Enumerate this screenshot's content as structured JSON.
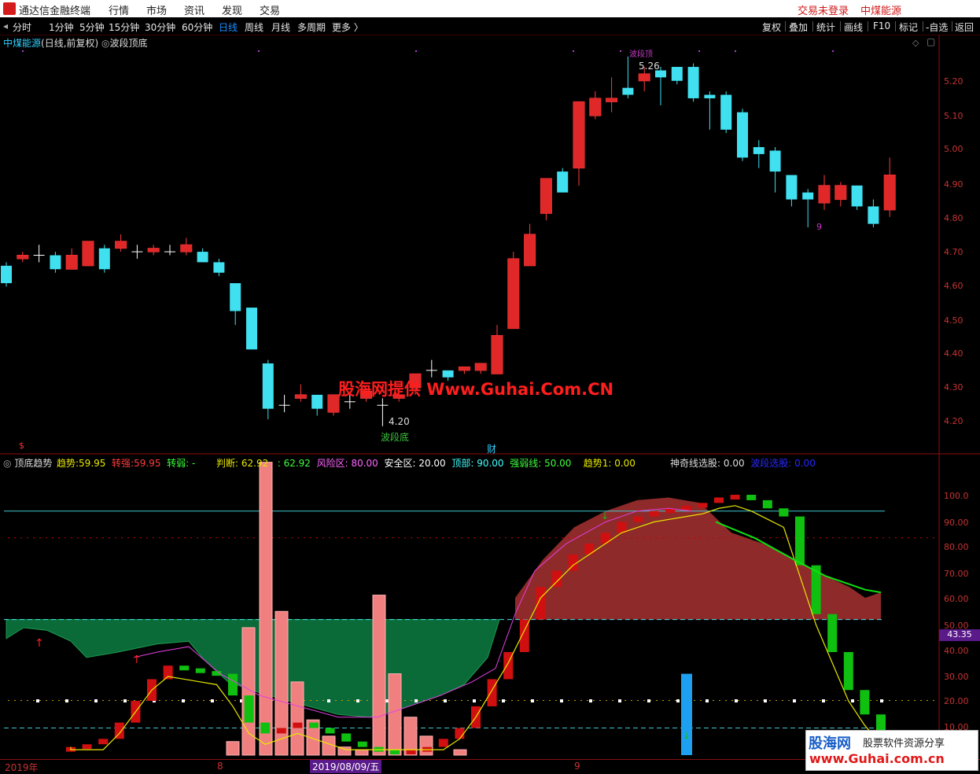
{
  "menubar": {
    "app_title": "通达信金融终端",
    "items": [
      "行情",
      "市场",
      "资讯",
      "发现",
      "交易"
    ],
    "login_status": "交易未登录",
    "stock": "中煤能源"
  },
  "toolbar": {
    "periods": [
      "分时",
      "1分钟",
      "5分钟",
      "15分钟",
      "30分钟",
      "60分钟",
      "日线",
      "周线",
      "月线",
      "多周期",
      "更多 〉"
    ],
    "active_period": "日线",
    "right_buttons": [
      "复权",
      "叠加",
      "统计",
      "画线",
      "F10",
      "标记",
      "-自选",
      "返回"
    ]
  },
  "main_chart": {
    "stock_name": "中煤能源",
    "mode": "(日线,前复权)",
    "indicator": "波段顶底",
    "high_label": "5.26",
    "low_label": "4.20",
    "low_note": "波段底",
    "top_note": "波段顶",
    "count_label": "9",
    "finance_mark": "财",
    "bottom_mark": "$",
    "watermark": "股海网提供 Www.Guhai.Com.CN",
    "yticks": [
      "5.20",
      "5.10",
      "5.00",
      "4.90",
      "4.80",
      "4.70",
      "4.60",
      "4.50",
      "4.40",
      "4.30",
      "4.20"
    ]
  },
  "indicator_panel": {
    "name": "顶底趋势",
    "fields": [
      {
        "label": "趋势:",
        "value": "59.95",
        "color": "#e8e800"
      },
      {
        "label": "转强:",
        "value": "59.95",
        "color": "#ff3c3c"
      },
      {
        "label": "转弱:",
        "value": "-",
        "color": "#3cff3c"
      },
      {
        "label": "判断:",
        "value": "62.92",
        "color": "#e8e800"
      },
      {
        "label": ":",
        "value": "62.92",
        "color": "#3cff3c"
      },
      {
        "label": "风险区:",
        "value": "80.00",
        "color": "#ff66ff"
      },
      {
        "label": "安全区:",
        "value": "20.00",
        "color": "#ffffff"
      },
      {
        "label": "顶部:",
        "value": "90.00",
        "color": "#40ffff"
      },
      {
        "label": "强弱线:",
        "value": "50.00",
        "color": "#3cff3c"
      },
      {
        "label": "趋势1:",
        "value": "0.00",
        "color": "#e8e800"
      }
    ],
    "extra1": {
      "label": "神奇线选股:",
      "value": "0.00"
    },
    "extra2": {
      "label": "波段选股:",
      "value": "0.00"
    },
    "current_value": "43.35",
    "yticks": [
      "100.0",
      "90.00",
      "80.00",
      "70.00",
      "60.00",
      "50.00",
      "40.00",
      "30.00",
      "20.00",
      "10.00"
    ]
  },
  "xaxis": {
    "labels": [
      "2019年",
      "8",
      "2019/08/09/五",
      "9"
    ]
  },
  "footer_logo": {
    "brand": "股海网",
    "slogan": "股票软件资源分享",
    "url": "www.Guhai.com.cn"
  },
  "chart_data": {
    "type": "candlestick",
    "price_range": [
      4.15,
      5.3
    ],
    "candles": [
      {
        "o": 4.66,
        "c": 4.61,
        "h": 4.67,
        "l": 4.6,
        "d": "down"
      },
      {
        "o": 4.68,
        "c": 4.69,
        "h": 4.7,
        "l": 4.67,
        "d": "up"
      },
      {
        "o": 4.69,
        "c": 4.69,
        "h": 4.72,
        "l": 4.67,
        "d": "flat"
      },
      {
        "o": 4.69,
        "c": 4.65,
        "h": 4.7,
        "l": 4.64,
        "d": "down"
      },
      {
        "o": 4.65,
        "c": 4.69,
        "h": 4.71,
        "l": 4.65,
        "d": "up"
      },
      {
        "o": 4.66,
        "c": 4.73,
        "h": 4.73,
        "l": 4.66,
        "d": "up"
      },
      {
        "o": 4.71,
        "c": 4.65,
        "h": 4.72,
        "l": 4.64,
        "d": "down"
      },
      {
        "o": 4.71,
        "c": 4.73,
        "h": 4.75,
        "l": 4.7,
        "d": "up"
      },
      {
        "o": 4.7,
        "c": 4.7,
        "h": 4.72,
        "l": 4.68,
        "d": "flat"
      },
      {
        "o": 4.7,
        "c": 4.71,
        "h": 4.72,
        "l": 4.69,
        "d": "up"
      },
      {
        "o": 4.7,
        "c": 4.7,
        "h": 4.72,
        "l": 4.69,
        "d": "flat"
      },
      {
        "o": 4.7,
        "c": 4.72,
        "h": 4.74,
        "l": 4.69,
        "d": "up"
      },
      {
        "o": 4.7,
        "c": 4.67,
        "h": 4.71,
        "l": 4.67,
        "d": "down"
      },
      {
        "o": 4.67,
        "c": 4.64,
        "h": 4.68,
        "l": 4.63,
        "d": "down"
      },
      {
        "o": 4.61,
        "c": 4.53,
        "h": 4.61,
        "l": 4.49,
        "d": "down"
      },
      {
        "o": 4.54,
        "c": 4.42,
        "h": 4.54,
        "l": 4.42,
        "d": "down"
      },
      {
        "o": 4.38,
        "c": 4.25,
        "h": 4.39,
        "l": 4.22,
        "d": "down"
      },
      {
        "o": 4.26,
        "c": 4.26,
        "h": 4.29,
        "l": 4.24,
        "d": "flat"
      },
      {
        "o": 4.28,
        "c": 4.29,
        "h": 4.32,
        "l": 4.27,
        "d": "up"
      },
      {
        "o": 4.29,
        "c": 4.25,
        "h": 4.29,
        "l": 4.23,
        "d": "down"
      },
      {
        "o": 4.24,
        "c": 4.29,
        "h": 4.29,
        "l": 4.23,
        "d": "up"
      },
      {
        "o": 4.27,
        "c": 4.27,
        "h": 4.29,
        "l": 4.25,
        "d": "flat"
      },
      {
        "o": 4.28,
        "c": 4.3,
        "h": 4.31,
        "l": 4.27,
        "d": "up"
      },
      {
        "o": 4.26,
        "c": 4.26,
        "h": 4.28,
        "l": 4.2,
        "d": "flat"
      },
      {
        "o": 4.28,
        "c": 4.29,
        "h": 4.31,
        "l": 4.27,
        "d": "up"
      },
      {
        "o": 4.31,
        "c": 4.35,
        "h": 4.35,
        "l": 4.29,
        "d": "up"
      },
      {
        "o": 4.36,
        "c": 4.36,
        "h": 4.39,
        "l": 4.34,
        "d": "flat"
      },
      {
        "o": 4.36,
        "c": 4.34,
        "h": 4.36,
        "l": 4.33,
        "d": "down"
      },
      {
        "o": 4.36,
        "c": 4.37,
        "h": 4.37,
        "l": 4.35,
        "d": "up"
      },
      {
        "o": 4.36,
        "c": 4.38,
        "h": 4.38,
        "l": 4.35,
        "d": "up"
      },
      {
        "o": 4.35,
        "c": 4.46,
        "h": 4.49,
        "l": 4.35,
        "d": "up"
      },
      {
        "o": 4.48,
        "c": 4.68,
        "h": 4.7,
        "l": 4.48,
        "d": "up"
      },
      {
        "o": 4.66,
        "c": 4.75,
        "h": 4.78,
        "l": 4.66,
        "d": "up"
      },
      {
        "o": 4.81,
        "c": 4.91,
        "h": 4.91,
        "l": 4.79,
        "d": "up"
      },
      {
        "o": 4.87,
        "c": 4.93,
        "h": 4.94,
        "l": 4.87,
        "d": "down"
      },
      {
        "o": 4.94,
        "c": 5.13,
        "h": 5.13,
        "l": 4.89,
        "d": "up"
      },
      {
        "o": 5.09,
        "c": 5.14,
        "h": 5.16,
        "l": 5.08,
        "d": "up"
      },
      {
        "o": 5.13,
        "c": 5.14,
        "h": 5.2,
        "l": 5.1,
        "d": "up"
      },
      {
        "o": 5.15,
        "c": 5.17,
        "h": 5.26,
        "l": 5.14,
        "d": "down"
      },
      {
        "o": 5.19,
        "c": 5.21,
        "h": 5.23,
        "l": 5.16,
        "d": "up"
      },
      {
        "o": 5.22,
        "c": 5.2,
        "h": 5.23,
        "l": 5.12,
        "d": "down"
      },
      {
        "o": 5.23,
        "c": 5.19,
        "h": 5.23,
        "l": 5.18,
        "d": "down"
      },
      {
        "o": 5.23,
        "c": 5.14,
        "h": 5.24,
        "l": 5.13,
        "d": "down"
      },
      {
        "o": 5.15,
        "c": 5.14,
        "h": 5.16,
        "l": 5.05,
        "d": "down"
      },
      {
        "o": 5.15,
        "c": 5.05,
        "h": 5.16,
        "l": 5.04,
        "d": "down"
      },
      {
        "o": 5.1,
        "c": 4.97,
        "h": 5.11,
        "l": 4.96,
        "d": "down"
      },
      {
        "o": 5.0,
        "c": 4.98,
        "h": 5.02,
        "l": 4.94,
        "d": "down"
      },
      {
        "o": 4.99,
        "c": 4.93,
        "h": 5.0,
        "l": 4.87,
        "d": "down"
      },
      {
        "o": 4.92,
        "c": 4.85,
        "h": 4.92,
        "l": 4.83,
        "d": "down"
      },
      {
        "o": 4.87,
        "c": 4.85,
        "h": 4.88,
        "l": 4.77,
        "d": "down"
      },
      {
        "o": 4.84,
        "c": 4.89,
        "h": 4.92,
        "l": 4.82,
        "d": "up"
      },
      {
        "o": 4.89,
        "c": 4.85,
        "h": 4.9,
        "l": 4.83,
        "d": "up"
      },
      {
        "o": 4.89,
        "c": 4.83,
        "h": 4.89,
        "l": 4.82,
        "d": "down"
      },
      {
        "o": 4.83,
        "c": 4.78,
        "h": 4.85,
        "l": 4.77,
        "d": "down"
      },
      {
        "o": 4.82,
        "c": 4.92,
        "h": 4.97,
        "l": 4.8,
        "d": "up"
      }
    ],
    "indicator_range": [
      0,
      105
    ],
    "trend_bars": [
      3,
      4,
      6,
      12,
      20,
      28,
      33,
      32,
      31,
      30,
      22,
      12,
      8,
      10,
      12,
      10,
      8,
      5,
      3,
      2,
      1,
      2,
      3,
      6,
      10,
      18,
      28,
      38,
      50,
      62,
      68,
      74,
      78,
      82,
      86,
      88,
      90,
      91,
      92,
      93,
      95,
      96,
      94,
      91,
      88,
      70,
      52,
      38,
      24,
      15,
      8,
      5
    ]
  }
}
